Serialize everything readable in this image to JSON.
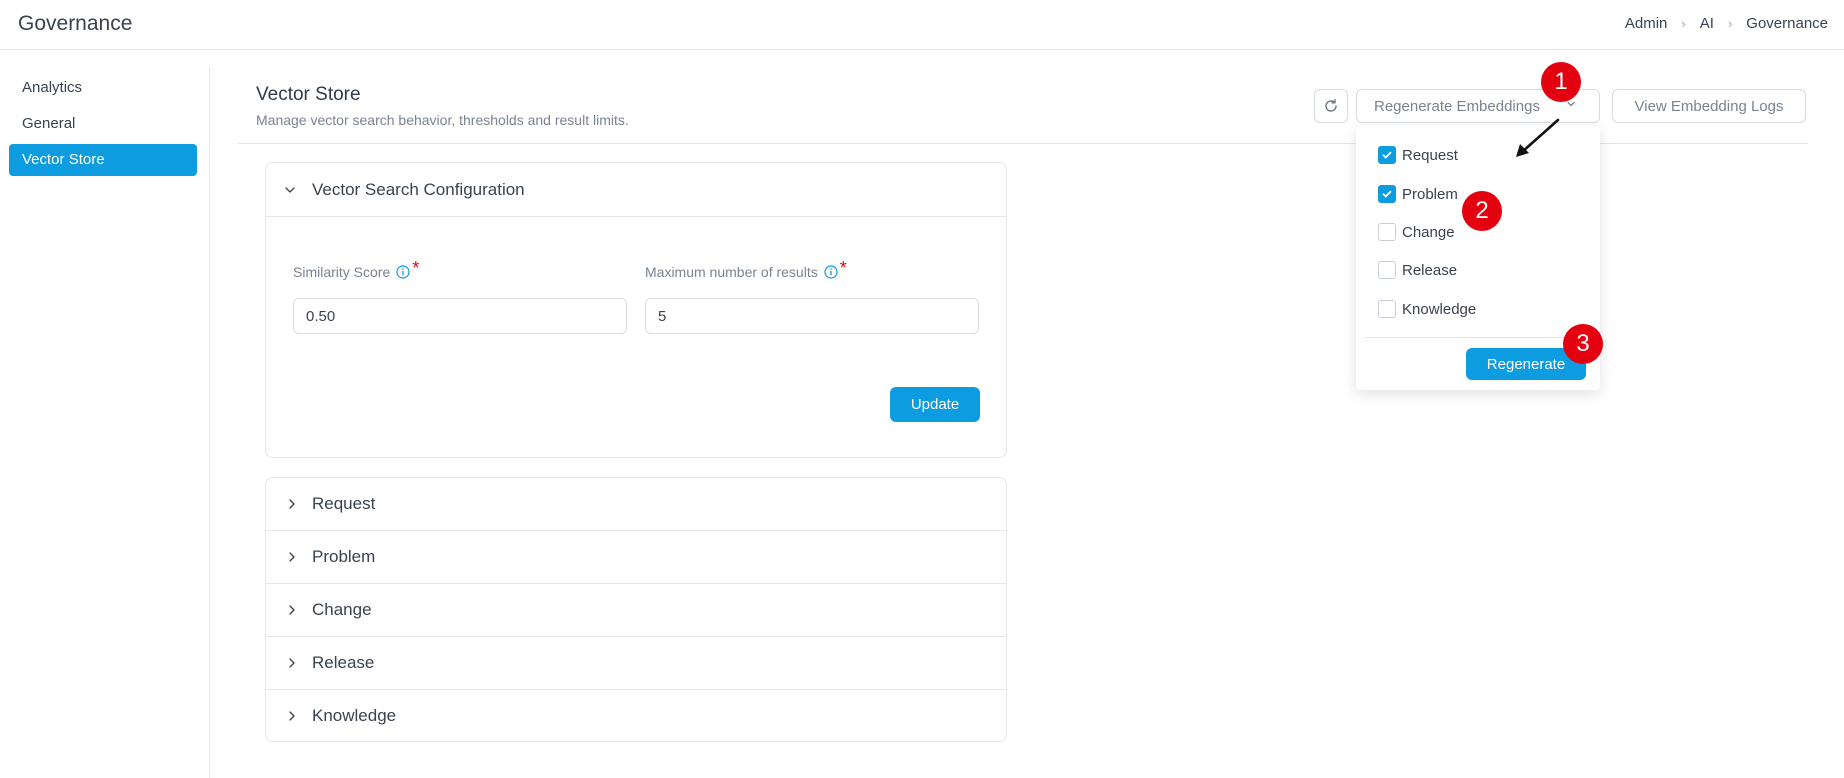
{
  "header": {
    "app_title": "Governance",
    "breadcrumb": [
      "Admin",
      "AI",
      "Governance"
    ]
  },
  "sidebar": {
    "items": [
      {
        "label": "Analytics",
        "active": false
      },
      {
        "label": "General",
        "active": false
      },
      {
        "label": "Vector Store",
        "active": true
      }
    ]
  },
  "page": {
    "title": "Vector Store",
    "subtitle": "Manage vector search behavior, thresholds and result limits."
  },
  "toolbar": {
    "refresh_icon": "refresh-icon",
    "regenerate_label": "Regenerate Embeddings",
    "logs_label": "View Embedding Logs"
  },
  "dropdown": {
    "options": [
      {
        "label": "Request",
        "checked": true
      },
      {
        "label": "Problem",
        "checked": true
      },
      {
        "label": "Change",
        "checked": false
      },
      {
        "label": "Release",
        "checked": false
      },
      {
        "label": "Knowledge",
        "checked": false
      }
    ],
    "submit_label": "Regenerate"
  },
  "callouts": [
    "1",
    "2",
    "3"
  ],
  "config": {
    "title": "Vector Search Configuration",
    "similarity_label": "Similarity Score",
    "similarity_value": "0.50",
    "max_results_label": "Maximum number of results",
    "max_results_value": "5",
    "required_mark": "*",
    "update_label": "Update"
  },
  "accordions": [
    "Request",
    "Problem",
    "Change",
    "Release",
    "Knowledge"
  ],
  "colors": {
    "accent": "#0d9ce0",
    "callout": "#e3000f",
    "border": "#e3e6ea"
  }
}
